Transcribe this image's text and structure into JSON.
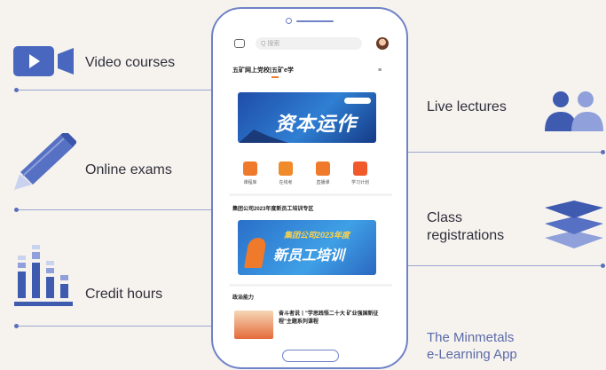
{
  "features": {
    "video_courses": "Video courses",
    "online_exams": "Online exams",
    "credit_hours": "Credit hours",
    "live_lectures": "Live lectures",
    "class_registrations": "Class\nregistrations"
  },
  "caption": "The Minmetals\ne-Learning App",
  "phone": {
    "search_placeholder": "Q 搜索",
    "header_title": "五矿网上党校|五矿e学",
    "banner1_text": "资本运作",
    "quick_icons": [
      "课程库",
      "在线考",
      "直播课",
      "学习计划"
    ],
    "section1_title": "集团公司2023年度新员工培训专区",
    "banner2_title": "集团公司2023年度",
    "banner2_text": "新员工培训",
    "section2_title": "政治能力",
    "news_text": "奋斗者说丨\"学思践悟二十大 矿业强国新征程\"主题系列课程"
  },
  "colors": {
    "accent": "#5a6fb8",
    "icon_blue": "#3f5bb0",
    "orange": "#f07a2b"
  }
}
